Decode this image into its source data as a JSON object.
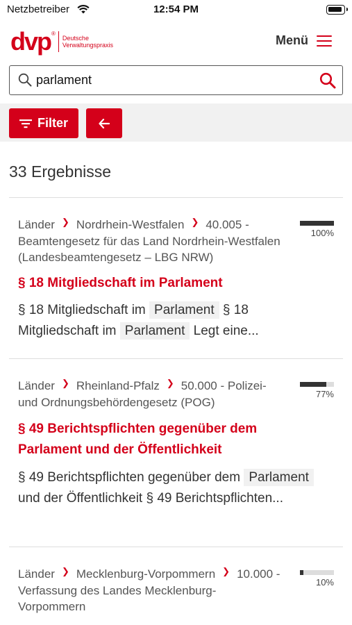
{
  "status_bar": {
    "carrier": "Netzbetreiber",
    "time": "12:54 PM"
  },
  "header": {
    "logo_mark": "dvp",
    "logo_reg": "®",
    "logo_line1": "Deutsche",
    "logo_line2": "Verwaltungspraxis",
    "menu_label": "Menü"
  },
  "search": {
    "value": "parlament",
    "placeholder": ""
  },
  "toolbar": {
    "filter_label": "Filter"
  },
  "results_count": "33 Ergebnisse",
  "colors": {
    "accent": "#d4001a",
    "toolbar_bg": "#f1f1f1"
  },
  "results": [
    {
      "crumbs": [
        "Länder",
        "Nordrhein-Westfalen",
        "40.005 - Beamtengesetz für das Land Nordrhein-Westfalen (Landesbeamtengesetz – LBG NRW)"
      ],
      "score": "100%",
      "score_value": 1.0,
      "title": "§ 18 Mitgliedschaft im Parlament",
      "snippet_a": "§ 18 Mitgliedschaft im",
      "snippet_hl1": "Parlament",
      "snippet_b": "§ 18 Mitgliedschaft im",
      "snippet_hl2": "Parlament",
      "snippet_c": "Legt eine..."
    },
    {
      "crumbs": [
        "Länder",
        "Rheinland-Pfalz",
        "50.000 - Polizei- und Ordnungsbehördengesetz (POG)"
      ],
      "score": "77%",
      "score_value": 0.77,
      "title": "§ 49 Berichtspflichten gegenüber dem Parlament und der Öffentlichkeit",
      "snippet_a": "§ 49 Berichtspflichten gegenüber dem",
      "snippet_hl1": "Parlament",
      "snippet_b": "und der Öffentlichkeit § 49 Berichtspflichten..."
    },
    {
      "crumbs": [
        "Länder",
        "Mecklenburg-Vorpommern",
        "10.000 - Verfassung des Landes Mecklenburg-Vorpommern"
      ],
      "score": "10%",
      "score_value": 0.1
    }
  ]
}
